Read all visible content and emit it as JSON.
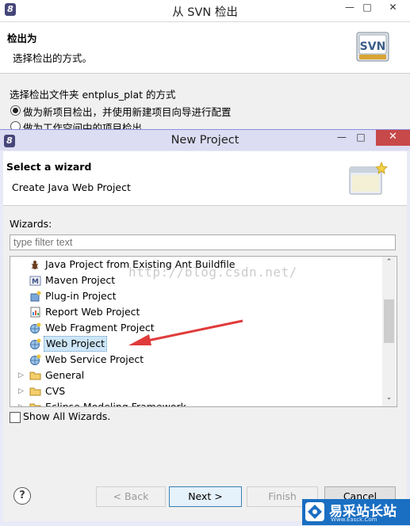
{
  "svn_window": {
    "title": "从 SVN 检出",
    "header_title": "检出为",
    "header_desc": "选择检出的方式。",
    "logo_text": "SVN",
    "option_label": "选择检出文件夹 entplus_plat 的方式",
    "options": [
      {
        "label": "做为新项目检出，并使用新建项目向导进行配置",
        "checked": true
      },
      {
        "label": "做为工作空间中的项目检出",
        "checked": false
      }
    ],
    "btn_min": "—",
    "btn_max": "□",
    "btn_close": "✕"
  },
  "new_project": {
    "title": "New Project",
    "header_title": "Select a wizard",
    "header_desc": "Create Java Web Project",
    "wizards_label": "Wizards:",
    "filter_placeholder": "type filter text",
    "tree_items": [
      {
        "label": "Java Project from Existing Ant Buildfile",
        "icon": "ant-icon",
        "type": "leaf"
      },
      {
        "label": "Maven Project",
        "icon": "maven-icon",
        "type": "leaf"
      },
      {
        "label": "Plug-in Project",
        "icon": "plugin-icon",
        "type": "leaf"
      },
      {
        "label": "Report Web Project",
        "icon": "report-icon",
        "type": "leaf"
      },
      {
        "label": "Web Fragment Project",
        "icon": "globe-icon",
        "type": "leaf"
      },
      {
        "label": "Web Project",
        "icon": "globe-icon",
        "type": "leaf",
        "selected": true
      },
      {
        "label": "Web Service Project",
        "icon": "globe-icon",
        "type": "leaf"
      },
      {
        "label": "General",
        "icon": "folder-icon",
        "type": "folder"
      },
      {
        "label": "CVS",
        "icon": "folder-icon",
        "type": "folder"
      },
      {
        "label": "Eclipse Modeling Framework",
        "icon": "folder-icon",
        "type": "folder"
      }
    ],
    "watermark": "http://blog.csdn.net/",
    "show_all_label": "Show All Wizards.",
    "show_all_checked": false,
    "buttons": {
      "help": "?",
      "back": "< Back",
      "next": "Next >",
      "finish": "Finish",
      "cancel": "Cancel"
    },
    "btn_min": "—",
    "btn_max": "□",
    "btn_close": "✕"
  },
  "site_badge": {
    "name": "易采站长站",
    "sub": "Www.Easck.Com"
  },
  "colors": {
    "arrow": "#e03b3b",
    "selection": "#cde6f7",
    "badge": "#1a6fc2",
    "titlebar_active": "#dcdcf2"
  }
}
